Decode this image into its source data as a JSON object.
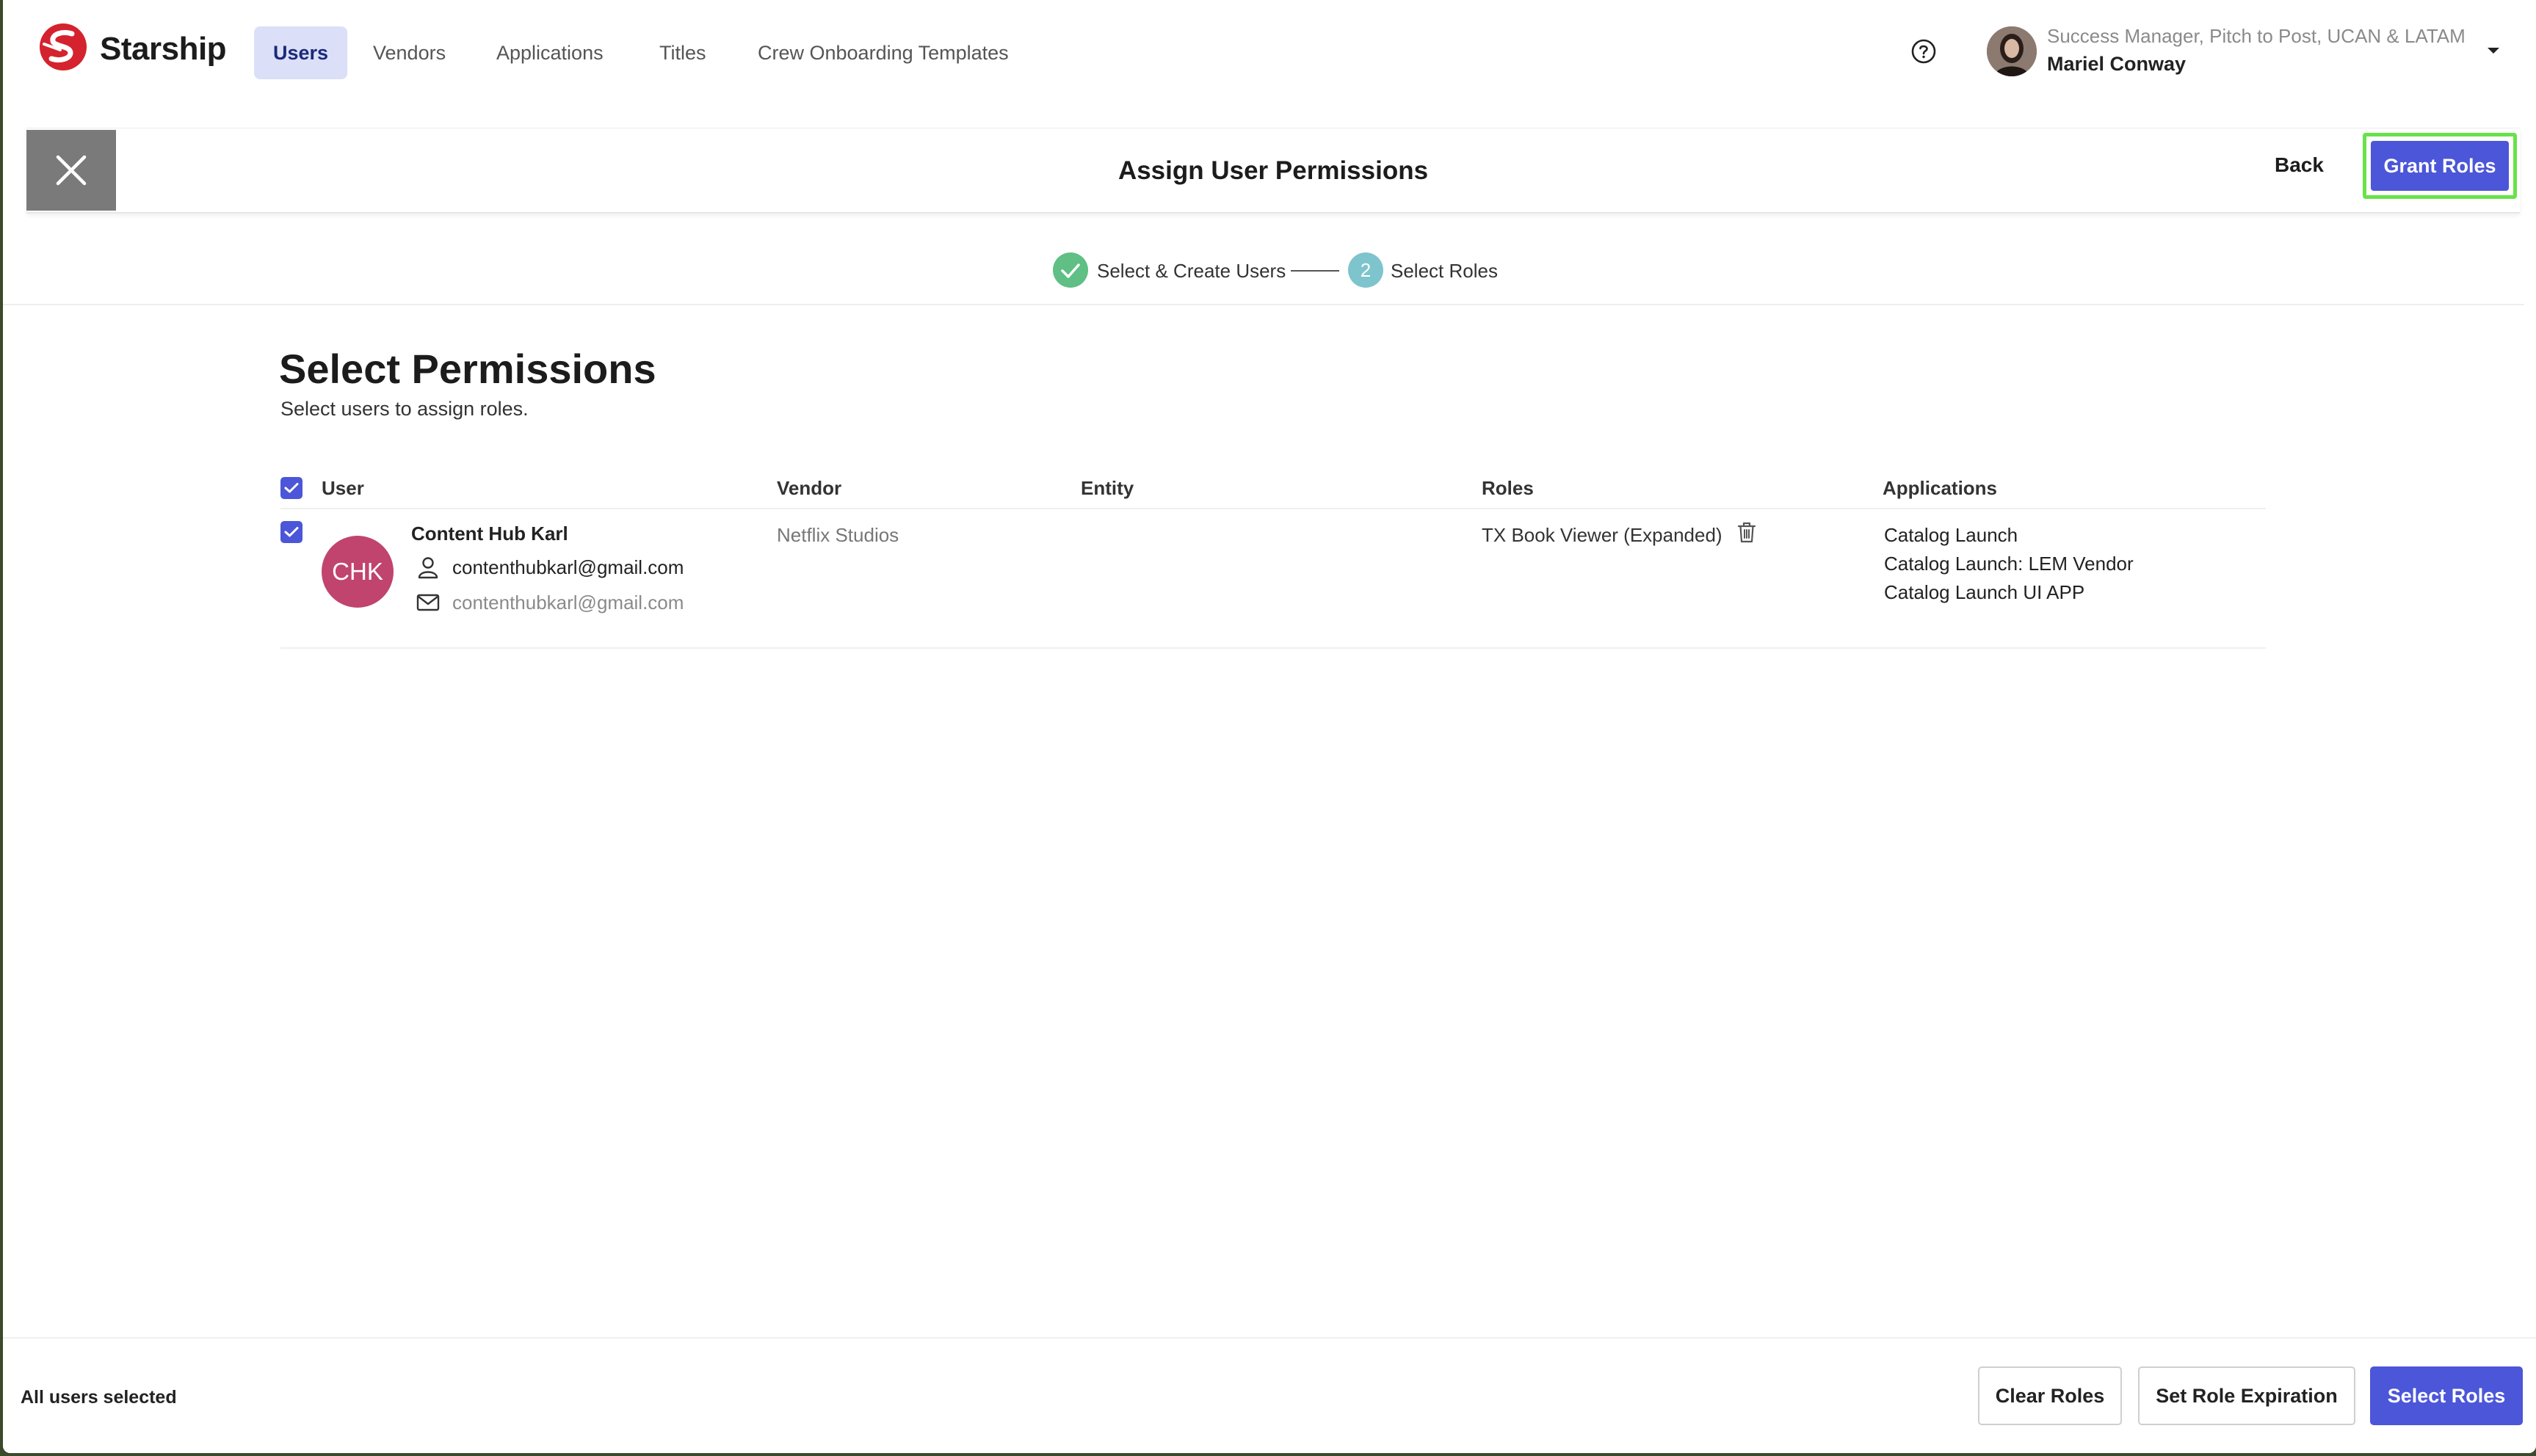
{
  "brand": {
    "name": "Starship",
    "accent": "#d4232e"
  },
  "nav": {
    "tabs": [
      {
        "label": "Users",
        "active": true
      },
      {
        "label": "Vendors",
        "active": false
      },
      {
        "label": "Applications",
        "active": false
      },
      {
        "label": "Titles",
        "active": false
      },
      {
        "label": "Crew Onboarding Templates",
        "active": false
      }
    ]
  },
  "user_menu": {
    "role": "Success Manager, Pitch to Post, UCAN & LATAM",
    "name": "Mariel Conway",
    "help_icon": "question-circle-icon",
    "caret_icon": "caret-down-icon"
  },
  "header": {
    "title": "Assign User Permissions",
    "close_icon": "close-icon",
    "back_label": "Back",
    "grant_label": "Grant Roles"
  },
  "stepper": {
    "steps": [
      {
        "label": "Select & Create Users",
        "number": "",
        "status": "complete",
        "color": "#5fbf84"
      },
      {
        "label": "Select Roles",
        "number": "2",
        "status": "current",
        "color": "#7ec4cc"
      }
    ]
  },
  "main": {
    "title": "Select Permissions",
    "subtitle": "Select users to assign roles."
  },
  "table": {
    "columns": [
      "User",
      "Vendor",
      "Entity",
      "Roles",
      "Applications"
    ],
    "rows": [
      {
        "selected": true,
        "initials": "CHK",
        "avatar_color": "#c0446d",
        "name": "Content Hub Karl",
        "username": "contenthubkarl@gmail.com",
        "email": "contenthubkarl@gmail.com",
        "vendor": "Netflix Studios",
        "entity": "",
        "role": "TX Book Viewer (Expanded)",
        "applications": [
          "Catalog Launch",
          "Catalog Launch: LEM Vendor",
          "Catalog Launch UI APP"
        ]
      }
    ]
  },
  "footer": {
    "status": "All users selected",
    "clear_label": "Clear Roles",
    "expiration_label": "Set Role Expiration",
    "select_label": "Select Roles"
  },
  "colors": {
    "primary": "#4b56d8",
    "highlight": "#68e24a",
    "active_tab_bg": "#dcdff8"
  }
}
